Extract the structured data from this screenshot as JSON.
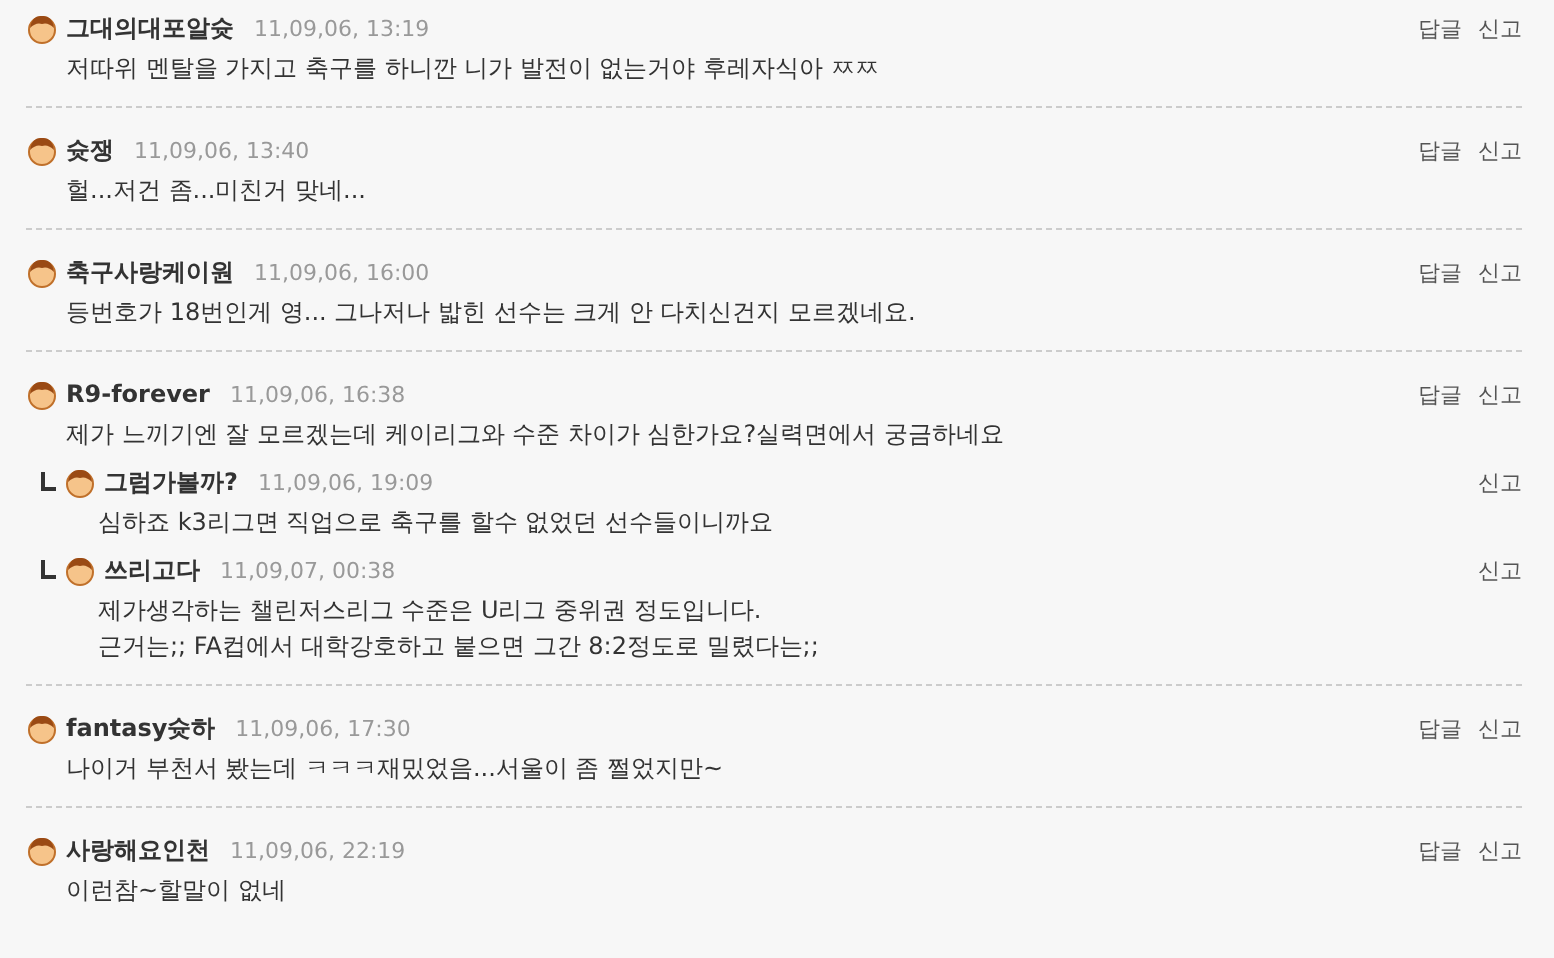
{
  "comments": [
    {
      "author": "그대의대포알슛",
      "date": "11,09,06, 13:19",
      "lines": [
        "저따위 멘탈을 가지고 축구를 하니깐 니가 발전이 없는거야 후레자식아 ㅉㅉ"
      ],
      "actions": [
        "답글",
        "신고"
      ]
    },
    {
      "author": "슛쟁",
      "date": "11,09,06, 13:40",
      "lines": [
        "헐...저건 좀...미친거 맞네..."
      ],
      "actions": [
        "답글",
        "신고"
      ]
    },
    {
      "author": "축구사랑케이원",
      "date": "11,09,06, 16:00",
      "lines": [
        "등번호가 18번인게 영... 그나저나 밟힌 선수는 크게 안 다치신건지 모르겠네요."
      ],
      "actions": [
        "답글",
        "신고"
      ]
    },
    {
      "author": "R9-forever",
      "date": "11,09,06, 16:38",
      "lines": [
        "제가 느끼기엔 잘 모르겠는데 케이리그와 수준 차이가 심한가요?실력면에서 궁금하네요"
      ],
      "actions": [
        "답글",
        "신고"
      ],
      "replies": [
        {
          "author": "그럼가볼까?",
          "date": "11,09,06, 19:09",
          "lines": [
            "심하죠 k3리그면 직업으로 축구를 할수 없었던 선수들이니까요"
          ],
          "actions": [
            "신고"
          ]
        },
        {
          "author": "쓰리고다",
          "date": "11,09,07, 00:38",
          "lines": [
            "제가생각하는 챌린저스리그 수준은 U리그 중위권 정도입니다.",
            "근거는;; FA컵에서 대학강호하고 붙으면 그간 8:2정도로 밀렸다는;;"
          ],
          "actions": [
            "신고"
          ]
        }
      ]
    },
    {
      "author": "fantasy슛하",
      "date": "11,09,06, 17:30",
      "lines": [
        "나이거 부천서 봤는데 ㅋㅋㅋ재밌었음...서울이 좀 쩔었지만~"
      ],
      "actions": [
        "답글",
        "신고"
      ]
    },
    {
      "author": "사랑해요인천",
      "date": "11,09,06, 22:19",
      "lines": [
        "이런참~할말이 없네"
      ],
      "actions": [
        "답글",
        "신고"
      ]
    }
  ]
}
